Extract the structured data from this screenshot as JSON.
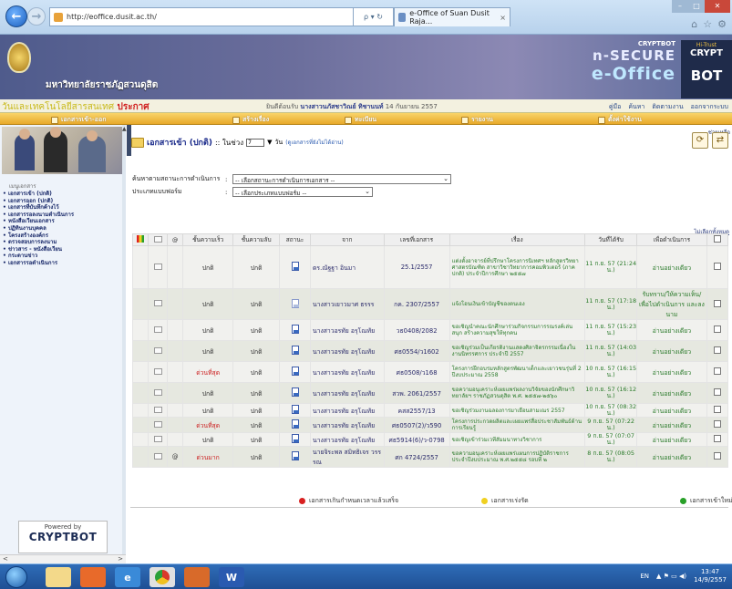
{
  "browser": {
    "url": "http://eoffice.dusit.ac.th/",
    "url_tools": "ρ ▾ ↻",
    "tab_title": "e-Office of Suan Dusit Raja...",
    "tab_close": "×",
    "back": "←",
    "forward": "→"
  },
  "banner": {
    "site_title": "มหาวิทยาลัยราชภัฏสวนดุสิต",
    "secure_top": "CRYPTBOT",
    "secure_mid": "n-SECURE",
    "secure_bottom": "e-Office",
    "crypt_top": "Hi-Trust",
    "crypt_mid": "CRYPT",
    "crypt_bottom": "BOT"
  },
  "infobar": {
    "marquee": "วันและเทคโนโลยีสารสนเทศ",
    "marquee_red": " ประกาศ",
    "user_prefix": "ยินดีต้อนรับ",
    "user_name": "นางสาวนภัสชาวิณย์ ทิชานนท์",
    "date": "14 กันยายน 2557",
    "links": [
      "คู่มือ",
      "ค้นหา",
      "ติดตามงาน",
      "ออกจากระบบ"
    ]
  },
  "menu": [
    {
      "label": "เอกสารเข้า-ออก"
    },
    {
      "label": "สร้างเรื่อง"
    },
    {
      "label": "ทะเบียน"
    },
    {
      "label": "รายงาน"
    },
    {
      "label": "ตั้งค่าใช้งาน"
    }
  ],
  "sidebar": {
    "heading": "เมนูเอกสาร",
    "items": [
      "เอกสารเข้า (ปกติ)",
      "เอกสารออก (ปกติ)",
      "เอกสารที่บันทึกค้างไว้",
      "เอกสารรอลงนามดำเนินการ",
      "หนังสือเวียนเอกสาร",
      "ปฏิทินงานบุคคล",
      "โครงสร้างองค์กร",
      "ตรวจสอบการลงนาม",
      "ข่าวสาร - หนังสือเวียน",
      "กระดานข่าว",
      "เอกสารรอดำเนินการ"
    ],
    "powered_by": "Powered by",
    "powered_brand": "CRYPTBOT"
  },
  "main": {
    "help": "ช่วยเหลือ",
    "title": "เอกสารเข้า (ปกติ)",
    "title_suffix": ":: ในช่วง",
    "per_page": "7",
    "unit": "วัน",
    "title_link": "(ดูเอกสารที่ยังไม่ได้อ่าน)",
    "filter_status_label": "ค้นหาตามสถานะการดำเนินการ",
    "filter_status_value": "-- เลือกสถานะการดำเนินการเอกสาร --",
    "filter_type_label": "ประเภทแบบฟอร์ม",
    "filter_type_value": "-- เลือกประเภทแบบฟอร์ม --",
    "select_all": "ไม่เลือกทั้งหมด",
    "colon": ":"
  },
  "table": {
    "headers": [
      "",
      "",
      "@",
      "ชั้นความเร็ว",
      "ชั้นความลับ",
      "สถานะ",
      "จาก",
      "เลขที่เอกสาร",
      "เรื่อง",
      "วันที่ได้รับ",
      "เพื่อดำเนินการ",
      ""
    ],
    "rows": [
      {
        "attach": "",
        "speed": "ปกติ",
        "secret": "ปกติ",
        "from": "ดร.ณัฐฐา อินมา",
        "docno": "25.1/2557",
        "subject": "แต่งตั้งอาจารย์ที่ปรึกษาโครงการนิเทศฯ หลักสูตรวิทยาศาสตรบัณฑิต สาขาวิชาวิทยาการคอมพิวเตอร์ (ภาคปกติ) ประจำปีการศึกษา ๒๕๕๗",
        "recv": "11 ก.ย. 57 (21:24 น.)",
        "action": "อ่านอย่างเดียว",
        "urgent": false
      },
      {
        "attach": "",
        "speed": "ปกติ",
        "secret": "ปกติ",
        "from": "นางสาวเยาวมาศ ธรรร",
        "docno": "กค. 2307/2557",
        "subject": "แจ้งโอนเงินเข้าบัญชีของตนเอง",
        "recv": "11 ก.ย. 57 (17:18 น.)",
        "action": "รับทราบ/ให้ความเห็น/ เพื่อไปดำเนินการ และลงนาม",
        "urgent": false
      },
      {
        "attach": "",
        "speed": "ปกติ",
        "secret": "ปกติ",
        "from": "นางสาวอรทัย อรุโณทัย",
        "docno": "วธ0408/2082",
        "subject": "ขอเชิญนำคณะนักศึกษาร่วมกิจกรรมการรณรงค์เล่น สนุก สร้างความสุขให้ทุกคน",
        "recv": "11 ก.ย. 57 (15:23 น.)",
        "action": "อ่านอย่างเดียว",
        "urgent": false
      },
      {
        "attach": "",
        "speed": "ปกติ",
        "secret": "ปกติ",
        "from": "นางสาวอรทัย อรุโณทัย",
        "docno": "ศธ0554/ว1602",
        "subject": "ขอเชิญร่วมเป็นเกียรติงานแสดงศิลาจิตรกรรมเนื่องในงานนิทรรศการ ประจำปี 2557",
        "recv": "11 ก.ย. 57 (14:03 น.)",
        "action": "อ่านอย่างเดียว",
        "urgent": false
      },
      {
        "attach": "",
        "speed": "ด่วนที่สุด",
        "secret": "ปกติ",
        "from": "นางสาวอรทัย อรุโณทัย",
        "docno": "ศธ0508/ว168",
        "subject": "โครงการฝึกอบรมหลักสูตรพัฒนาเด็กและเยาวชนรุ่นที่ 2 ปีงบประมาณ 2558",
        "recv": "10 ก.ย. 57 (16:15 น.)",
        "action": "อ่านอย่างเดียว",
        "urgent": true
      },
      {
        "attach": "",
        "speed": "ปกติ",
        "secret": "ปกติ",
        "from": "นางสาวอรทัย อรุโณทัย",
        "docno": "สวพ. 2061/2557",
        "subject": "ขอความอนุเคราะห์เผยแพร่ผลงานวิจัยของนักศึกษาวิทยาลัยฯ ราชภัฏสวนดุสิต พ.ศ. ๒๕๕๗-๒๕๖๐",
        "recv": "10 ก.ย. 57 (16:12 น.)",
        "action": "อ่านอย่างเดียว",
        "urgent": false
      },
      {
        "attach": "",
        "speed": "ปกติ",
        "secret": "ปกติ",
        "from": "นางสาวอรทัย อรุโณทัย",
        "docno": "คสส2557/13",
        "subject": "ขอเชิญร่วมงานฉลองการมาเยือนสามเณร 2557",
        "recv": "10 ก.ย. 57 (08:32 น.)",
        "action": "อ่านอย่างเดียว",
        "urgent": false
      },
      {
        "attach": "",
        "speed": "ด่วนที่สุด",
        "secret": "ปกติ",
        "from": "นางสาวอรทัย อรุโณทัย",
        "docno": "ศธ0507(2)/ว590",
        "subject": "โครงการประกวดผลิตและเผยแพร่สื่อประชาสัมพันธ์ด้านการเรียนรู้",
        "recv": "9 ก.ย. 57 (07:22 น.)",
        "action": "อ่านอย่างเดียว",
        "urgent": true
      },
      {
        "attach": "",
        "speed": "ปกติ",
        "secret": "ปกติ",
        "from": "นางสาวอรทัย อรุโณทัย",
        "docno": "ศธ5914(6)/ว-0798",
        "subject": "ขอเชิญเข้าร่วมเวทีสัมมนาทางวิชาการ",
        "recv": "9 ก.ย. 57 (07:07 น.)",
        "action": "อ่านอย่างเดียว",
        "urgent": false
      },
      {
        "attach": "@",
        "speed": "ด่วนมาก",
        "secret": "ปกติ",
        "from": "นายจิระพล สมิทธิเจร วรรรณ",
        "docno": "ศก 4724/2557",
        "subject": "ขอความอนุเคราะห์เผยแพร่แผนการปฏิบัติราชการ ประจำปีงบประมาณ พ.ศ.๒๕๕๘ รอบที่ ๒",
        "recv": "8 ก.ย. 57 (08:05 น.)",
        "action": "อ่านอย่างเดียว",
        "urgent": true
      }
    ]
  },
  "legend": [
    {
      "label": "เอกสารเกินกำหนดเวลาแล้วเสร็จ",
      "color": "#d82020"
    },
    {
      "label": "เอกสารเร่งรัด",
      "color": "#f0d020"
    },
    {
      "label": "เอกสารเข้าใหม่",
      "color": "#28a028"
    }
  ],
  "taskbar": {
    "apps": [
      "",
      "",
      "",
      "",
      "",
      "",
      "W"
    ],
    "lang": "EN",
    "time": "13:47",
    "date": "14/9/2557"
  },
  "colors": {
    "accent": "#e8a92a",
    "title_blue": "#1a2a8a",
    "urgent_red": "#cc2222"
  }
}
